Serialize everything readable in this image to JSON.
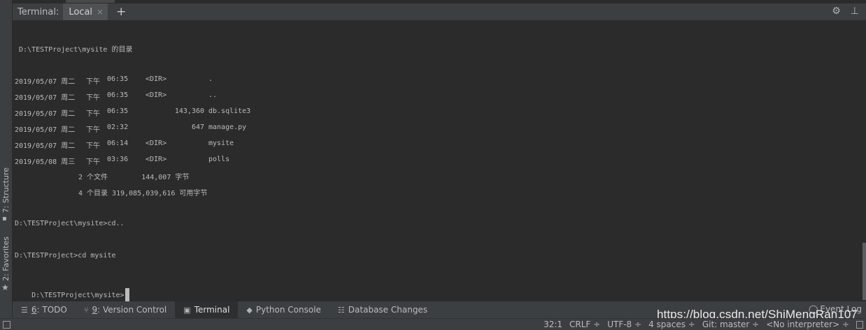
{
  "header": {
    "title": "Terminal:",
    "tab_label": "Local",
    "close_glyph": "×",
    "add_glyph": "+",
    "settings_glyph": "⚙",
    "minimize_glyph": "⊥"
  },
  "side_tabs": {
    "structure": "7: Structure",
    "favorites": "2: Favorites"
  },
  "terminal": {
    "dir_header": " D:\\TESTProject\\mysite 的目录",
    "listing": [
      {
        "date": "2019/05/07 周二",
        "ampm": "下午",
        "time": "06:35",
        "type": "<DIR>",
        "size": "",
        "name": "."
      },
      {
        "date": "2019/05/07 周二",
        "ampm": "下午",
        "time": "06:35",
        "type": "<DIR>",
        "size": "",
        "name": ".."
      },
      {
        "date": "2019/05/07 周二",
        "ampm": "下午",
        "time": "06:35",
        "type": "",
        "size": "143,360",
        "name": "db.sqlite3"
      },
      {
        "date": "2019/05/07 周二",
        "ampm": "下午",
        "time": "02:32",
        "type": "",
        "size": "647",
        "name": "manage.py"
      },
      {
        "date": "2019/05/07 周二",
        "ampm": "下午",
        "time": "06:14",
        "type": "<DIR>",
        "size": "",
        "name": "mysite"
      },
      {
        "date": "2019/05/08 周三",
        "ampm": "下午",
        "time": "03:36",
        "type": "<DIR>",
        "size": "",
        "name": "polls"
      }
    ],
    "summary_files": "2 个文件        144,007 字节",
    "summary_dirs": "4 个目录 319,085,039,616 可用字节",
    "cmd1": "D:\\TESTProject\\mysite>cd..",
    "cmd2": "D:\\TESTProject>cd mysite",
    "prompt": "D:\\TESTProject\\mysite>"
  },
  "toolbar": {
    "todo": {
      "key": "6",
      "label": ": TODO"
    },
    "version_control": {
      "key": "9",
      "label": ": Version Control"
    },
    "terminal": "Terminal",
    "python_console": "Python Console",
    "database_changes": "Database Changes",
    "event_log": "Event Log"
  },
  "status": {
    "position": "32:1",
    "line_sep": "CRLF ÷",
    "encoding": "UTF-8 ÷",
    "indent": "4 spaces ÷",
    "git": "Git: master ÷",
    "interpreter": "<No interpreter> ÷"
  },
  "watermark": "https://blog.csdn.net/ShiMengRan107"
}
